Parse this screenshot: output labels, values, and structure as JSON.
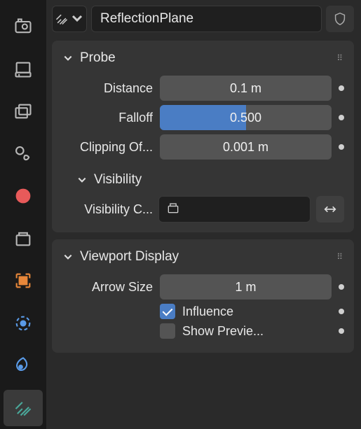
{
  "header": {
    "name": "ReflectionPlane"
  },
  "probe": {
    "title": "Probe",
    "distance_label": "Distance",
    "distance_value": "0.1 m",
    "falloff_label": "Falloff",
    "falloff_value": "0.500",
    "falloff_fraction": 0.5,
    "clipping_label": "Clipping Of...",
    "clipping_value": "0.001 m",
    "visibility_title": "Visibility",
    "visibility_coll_label": "Visibility C...",
    "visibility_coll_value": ""
  },
  "viewport": {
    "title": "Viewport Display",
    "arrow_label": "Arrow Size",
    "arrow_value": "1 m",
    "influence_label": "Influence",
    "influence_checked": true,
    "preview_label": "Show Previe...",
    "preview_checked": false
  }
}
